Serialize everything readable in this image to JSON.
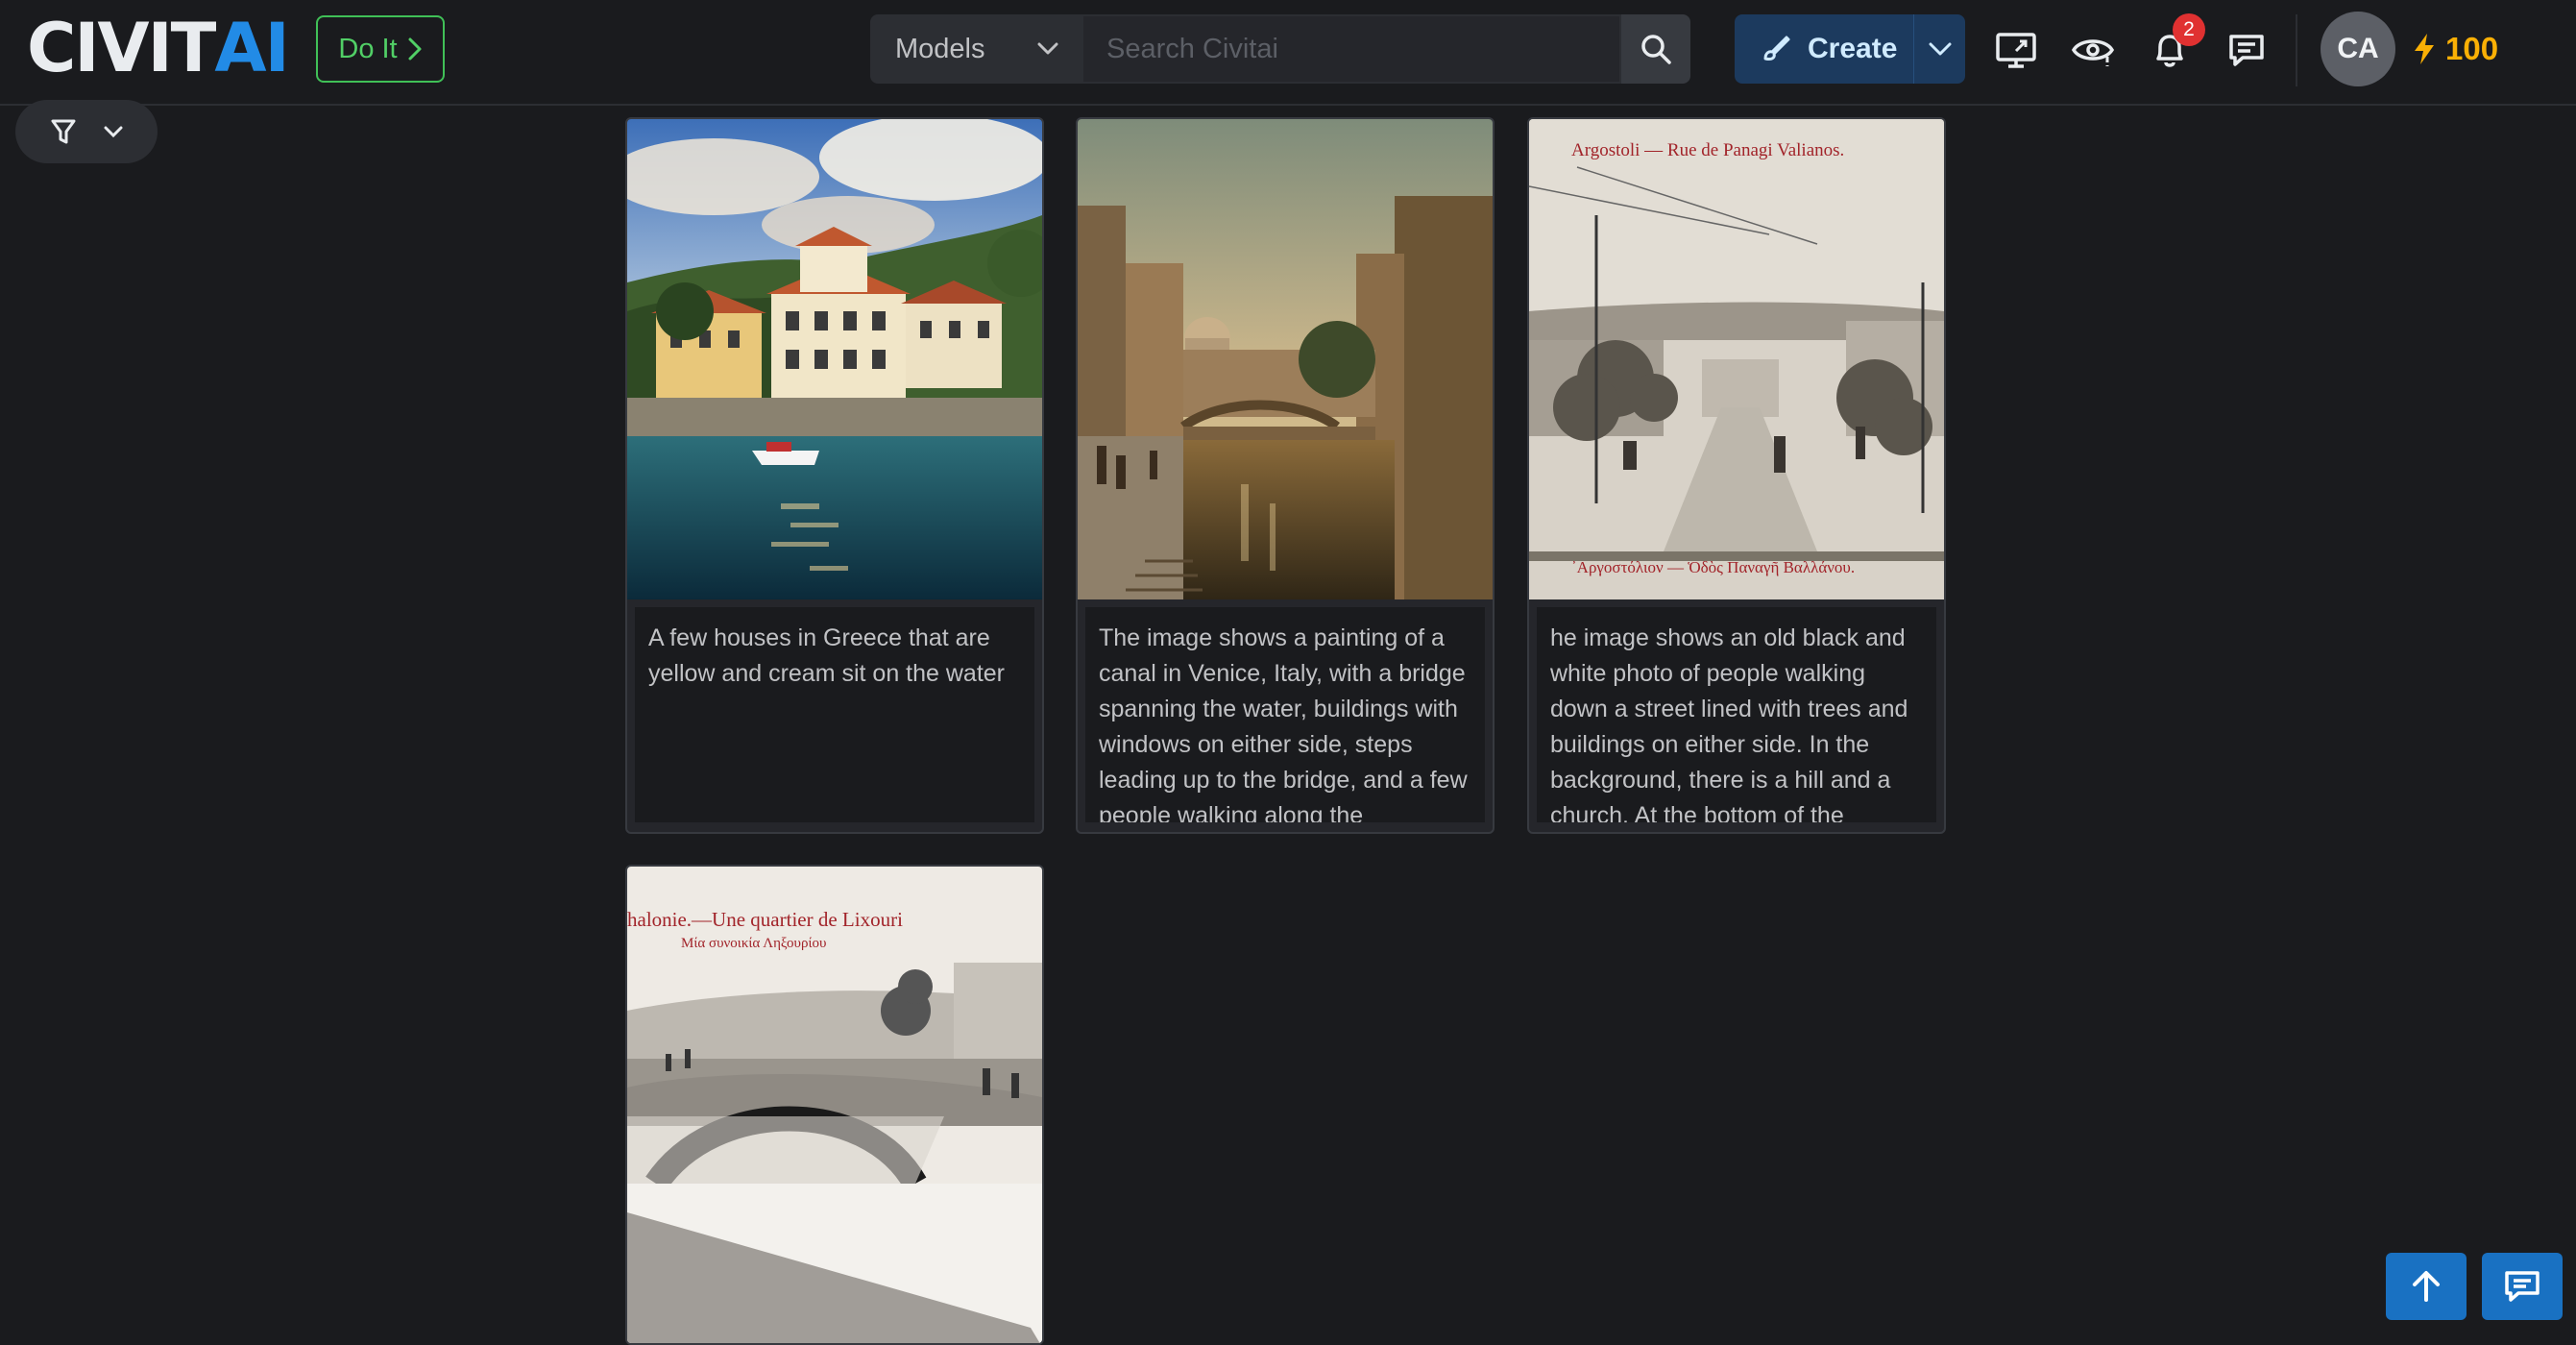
{
  "header": {
    "logo_main": "CIVIT",
    "logo_accent": "AI",
    "do_it_label": "Do It",
    "model_select": "Models",
    "search_placeholder": "Search Civitai",
    "search_hotkey": "/",
    "create_label": "Create",
    "notification_count": "2",
    "avatar_initials": "CA",
    "buzz_amount": "100"
  },
  "cards": [
    {
      "caption": "A few houses in Greece that are yellow and cream sit on the water"
    },
    {
      "caption": "The image shows a painting of a canal in Venice, Italy, with a bridge spanning the water, buildings with windows on either side, steps leading up to the bridge, and a few people walking along the"
    },
    {
      "caption": "he image shows an old black and white photo of people walking down a street lined with trees and buildings on either side. In the background, there is a hill and a church. At the bottom of the",
      "photo_top_text": "Argostoli — Rue de Panagi Valianos.",
      "photo_bottom_text": "᾿Αργοστόλιον — Ὁδὸς Παναγῆ Βαλλάνου."
    },
    {
      "caption": "",
      "photo_top_text": "halonie.—Une quartier de Lixouri",
      "photo_sub_text": "Μία συνοικία Ληξουρίου"
    }
  ],
  "colors": {
    "accent": "#228be6",
    "success": "#40c057",
    "buzz": "#fab005",
    "badge": "#e03131"
  }
}
